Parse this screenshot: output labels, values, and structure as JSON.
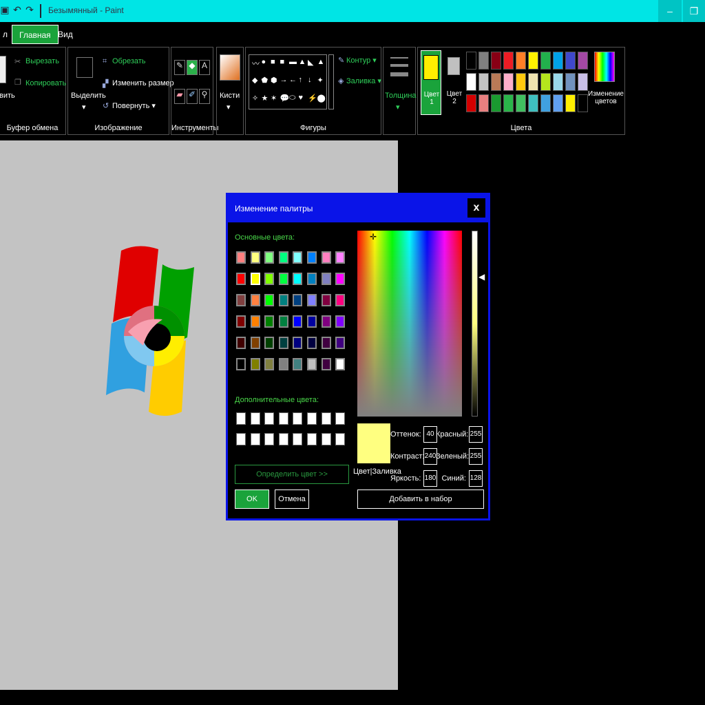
{
  "window": {
    "title": "Безымянный - Paint",
    "minimize_glyph": "–",
    "maximize_glyph": "❐"
  },
  "tabs": [
    {
      "label": "л"
    },
    {
      "label": "Главная"
    },
    {
      "label": "Вид"
    }
  ],
  "ribbon": {
    "clipboard": {
      "paste_label": "вить",
      "cut_label": "Вырезать",
      "copy_label": "Копировать",
      "group_label": "Буфер обмена"
    },
    "image": {
      "select_label": "Выделить",
      "crop_label": "Обрезать",
      "resize_label": "Изменить размер",
      "rotate_label": "Повернуть ▾",
      "group_label": "Изображение"
    },
    "tools": {
      "group_label": "Инструменты"
    },
    "brushes": {
      "label": "Кисти"
    },
    "shapes": {
      "outline_label": "Контур ▾",
      "fill_label": "Заливка ▾",
      "group_label": "Фигуры",
      "glyphs": [
        "〰",
        "●",
        "■",
        "■",
        "▬",
        "▲",
        "◣",
        "▲",
        "◆",
        "⬟",
        "⬢",
        "→",
        "←",
        "↑",
        "↓",
        "✦",
        "✧",
        "★",
        "✶",
        "💬",
        "⬭",
        "♥",
        "⚡",
        "⬤"
      ]
    },
    "thickness": {
      "label": "Толщина"
    },
    "colors": {
      "color1_label": "Цвет 1",
      "color2_label": "Цвет 2",
      "edit_label": "Изменение цветов",
      "group_label": "Цвета",
      "color1": "#ffee00",
      "color2": "#c0c0c0",
      "palette": [
        [
          "#000000",
          "#7f7f7f",
          "#880015",
          "#ed1c24",
          "#ff7f27",
          "#fff200",
          "#22b14c",
          "#00a2e8",
          "#3f48cc",
          "#a349a4"
        ],
        [
          "#ffffff",
          "#c3c3c3",
          "#b97a57",
          "#ffaec9",
          "#ffc90e",
          "#efe4b0",
          "#b5e61d",
          "#99d9ea",
          "#7092be",
          "#c8bfe7"
        ],
        [
          "#d40000",
          "#e88080",
          "#1a9a30",
          "#2ab54a",
          "#40c060",
          "#3fbfbf",
          "#40a0e0",
          "#60a0f0",
          "#ffee00",
          "#000000"
        ]
      ]
    }
  },
  "dialog": {
    "title": "Изменение палитры",
    "close_glyph": "x",
    "basic_label": "Основные цвета:",
    "custom_label": "Дополнительные цвета:",
    "define_button": "Определить цвет >>",
    "ok_button": "OK",
    "cancel_button": "Отмена",
    "add_button": "Добавить в набор",
    "preview_label": "Цвет|Заливка",
    "hue_label": "Оттенок:",
    "sat_label": "Контраст:",
    "lum_label": "Яркость:",
    "red_label": "Красный:",
    "green_label": "Зеленый:",
    "blue_label": "Синий:",
    "hue_value": "40",
    "sat_value": "240",
    "lum_value": "180",
    "red_value": "255",
    "green_value": "255",
    "blue_value": "128",
    "basic_colors": [
      [
        "#ff8080",
        "#ffff80",
        "#80ff80",
        "#00ff80",
        "#80ffff",
        "#0080ff",
        "#ff80c0",
        "#ff80ff"
      ],
      [
        "#ff0000",
        "#ffff00",
        "#80ff00",
        "#00ff40",
        "#00ffff",
        "#0080c0",
        "#8080c0",
        "#ff00ff"
      ],
      [
        "#804040",
        "#ff8040",
        "#00ff00",
        "#008080",
        "#004080",
        "#8080ff",
        "#800040",
        "#ff0080"
      ],
      [
        "#800000",
        "#ff8000",
        "#008000",
        "#008040",
        "#0000ff",
        "#0000a0",
        "#800080",
        "#8000ff"
      ],
      [
        "#400000",
        "#804000",
        "#004000",
        "#004040",
        "#000080",
        "#000040",
        "#400040",
        "#400080"
      ],
      [
        "#000000",
        "#808000",
        "#808040",
        "#808080",
        "#408080",
        "#c0c0c0",
        "#400040",
        "#ffffff"
      ]
    ]
  }
}
